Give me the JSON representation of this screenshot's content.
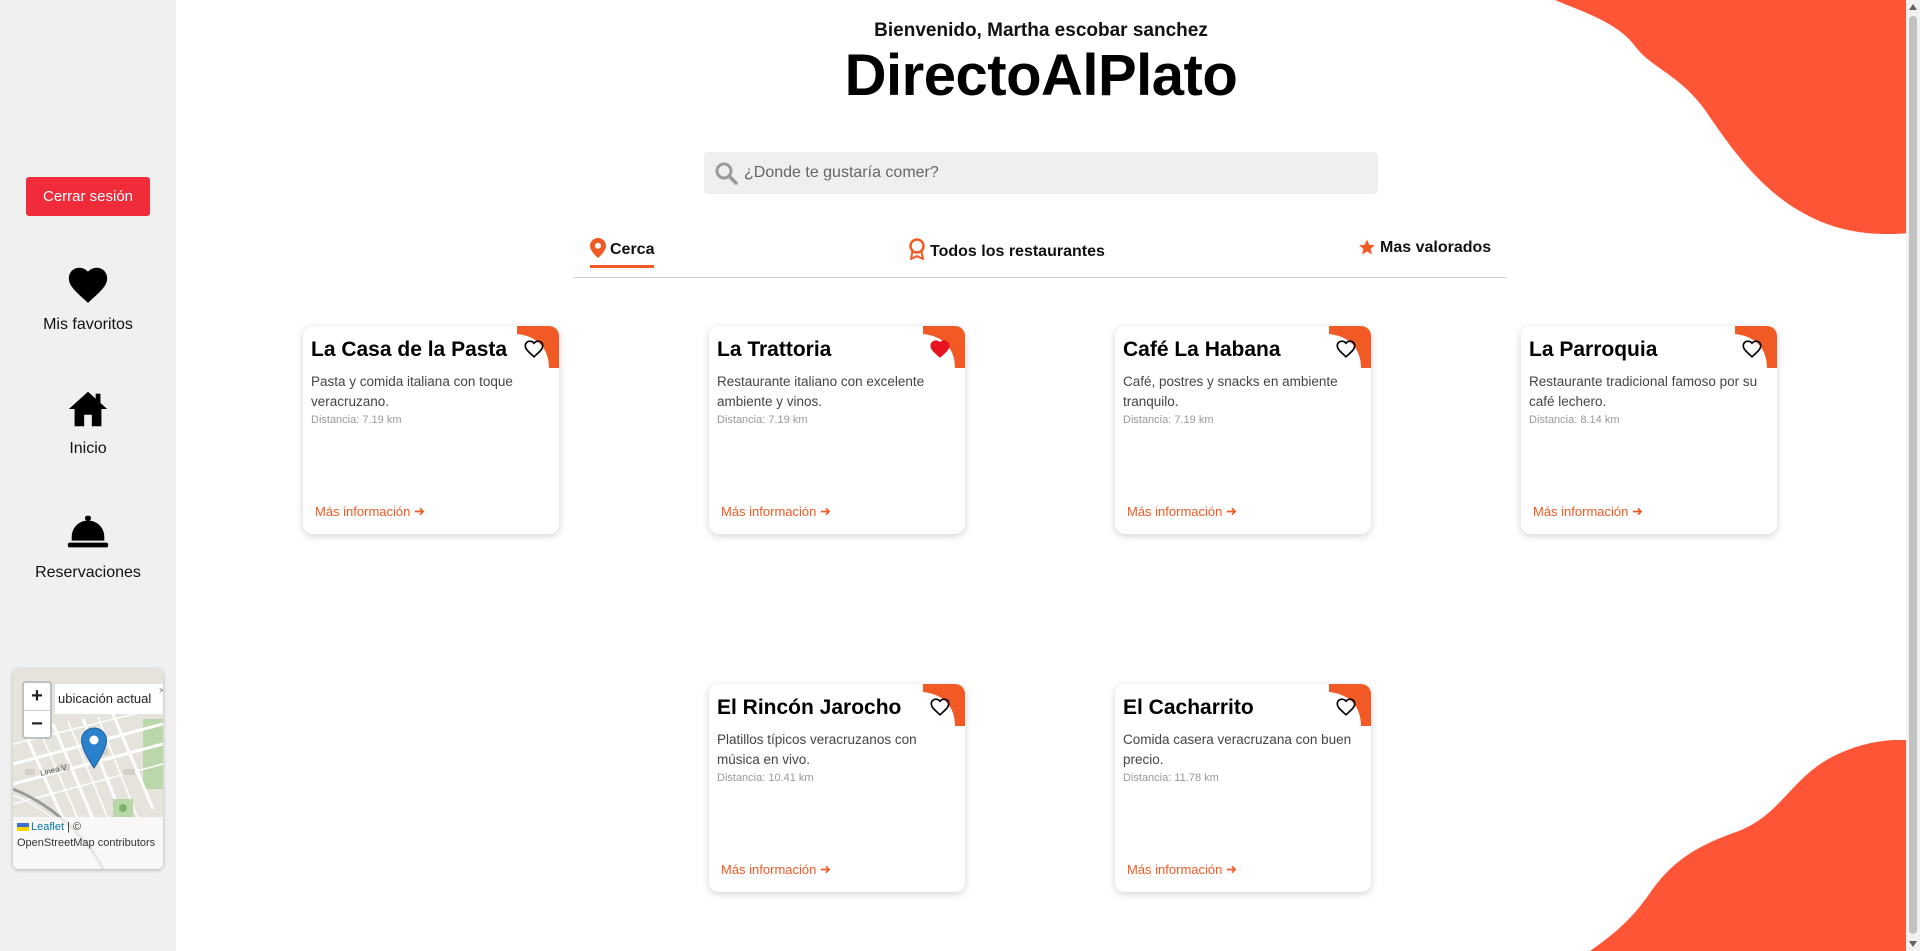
{
  "sidebar": {
    "logout_label": "Cerrar sesión",
    "items": [
      {
        "label": "Mis favoritos",
        "icon": "heart-icon"
      },
      {
        "label": "Inicio",
        "icon": "home-icon"
      },
      {
        "label": "Reservaciones",
        "icon": "service-bell-icon"
      }
    ],
    "map": {
      "zoom_in": "+",
      "zoom_out": "−",
      "popup_text": "ubicación actual",
      "popup_close": "×",
      "attribution_link": "Leaflet",
      "attribution_text": " | © OpenStreetMap contributors",
      "street_label": "Linea V"
    }
  },
  "header": {
    "welcome": "Bienvenido, Martha escobar sanchez",
    "brand": "DirectoAlPlato"
  },
  "search": {
    "placeholder": "¿Donde te gustaría comer?",
    "value": ""
  },
  "tabs": [
    {
      "label": "Cerca",
      "icon": "location-pin-icon",
      "active": true
    },
    {
      "label": "Todos los restaurantes",
      "icon": "award-badge-icon",
      "active": false
    },
    {
      "label": "Mas valorados",
      "icon": "star-icon",
      "active": false
    }
  ],
  "restaurants": [
    {
      "name": "La Casa de la Pasta",
      "description": "Pasta y comida italiana con toque veracruzano.",
      "distance": "Distancia: 7.19 km",
      "more": "Más información",
      "favorite": false
    },
    {
      "name": "La Trattoria",
      "description": "Restaurante italiano con excelente ambiente y vinos.",
      "distance": "Distancia: 7.19 km",
      "more": "Más información",
      "favorite": true
    },
    {
      "name": "Café La Habana",
      "description": "Café, postres y snacks en ambiente tranquilo.",
      "distance": "Distancia: 7.19 km",
      "more": "Más información",
      "favorite": false
    },
    {
      "name": "La Parroquia",
      "description": "Restaurante tradicional famoso por su café lechero.",
      "distance": "Distancia: 8.14 km",
      "more": "Más información",
      "favorite": false
    },
    {
      "name": "El Rincón Jarocho",
      "description": "Platillos típicos veracruzanos con música en vivo.",
      "distance": "Distancia: 10.41 km",
      "more": "Más información",
      "favorite": false
    },
    {
      "name": "El Cacharrito",
      "description": "Comida casera veracruzana con buen precio.",
      "distance": "Distancia: 11.78 km",
      "more": "Más información",
      "favorite": false
    }
  ],
  "colors": {
    "accent": "#f15a24",
    "logout": "#f02b3a",
    "blob": "#ff5537",
    "favorite_active": "#e8141f"
  }
}
